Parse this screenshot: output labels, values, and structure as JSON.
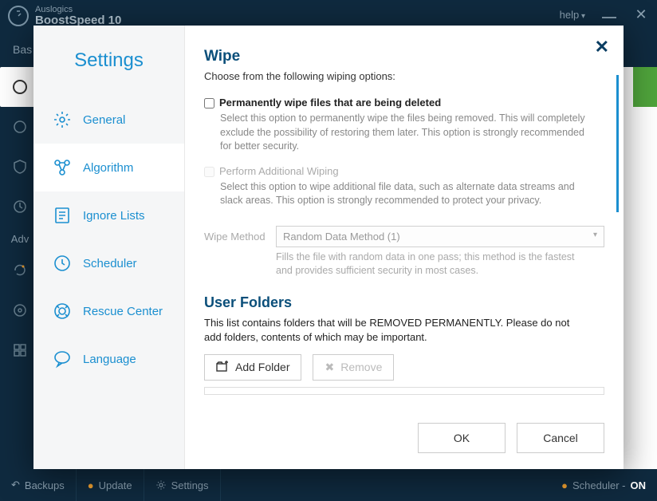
{
  "app": {
    "brand_line1": "Auslogics",
    "brand_line2": "BoostSpeed 10",
    "help": "help",
    "nav_left": "Bas",
    "adv_label": "Adv"
  },
  "bottom": {
    "backups": "Backups",
    "update": "Update",
    "settings": "Settings",
    "scheduler_label": "Scheduler - ",
    "scheduler_state": "ON"
  },
  "sidebar": {
    "title": "Settings",
    "items": [
      {
        "label": "General"
      },
      {
        "label": "Algorithm"
      },
      {
        "label": "Ignore Lists"
      },
      {
        "label": "Scheduler"
      },
      {
        "label": "Rescue Center"
      },
      {
        "label": "Language"
      }
    ]
  },
  "wipe": {
    "title": "Wipe",
    "subtitle": "Choose from the following wiping options:",
    "opt1_label": "Permanently wipe files that are being deleted",
    "opt1_desc": "Select this option to permanently wipe the files being removed. This will completely exclude the possibility of restoring them later. This option is strongly recommended for better security.",
    "opt2_label": "Perform Additional Wiping",
    "opt2_desc": "Select this option to wipe additional file data, such as alternate data streams and slack areas. This option is strongly recommended to protect your privacy.",
    "method_label": "Wipe Method",
    "method_value": "Random Data Method (1)",
    "method_desc": "Fills the file with random data in one pass; this method is the fastest and provides sufficient security in most cases."
  },
  "userfolders": {
    "title": "User Folders",
    "desc": "This list contains folders that will be REMOVED PERMANENTLY. Please do not add folders, contents of which may be important.",
    "add": "Add Folder",
    "remove": "Remove"
  },
  "dialog": {
    "ok": "OK",
    "cancel": "Cancel"
  }
}
